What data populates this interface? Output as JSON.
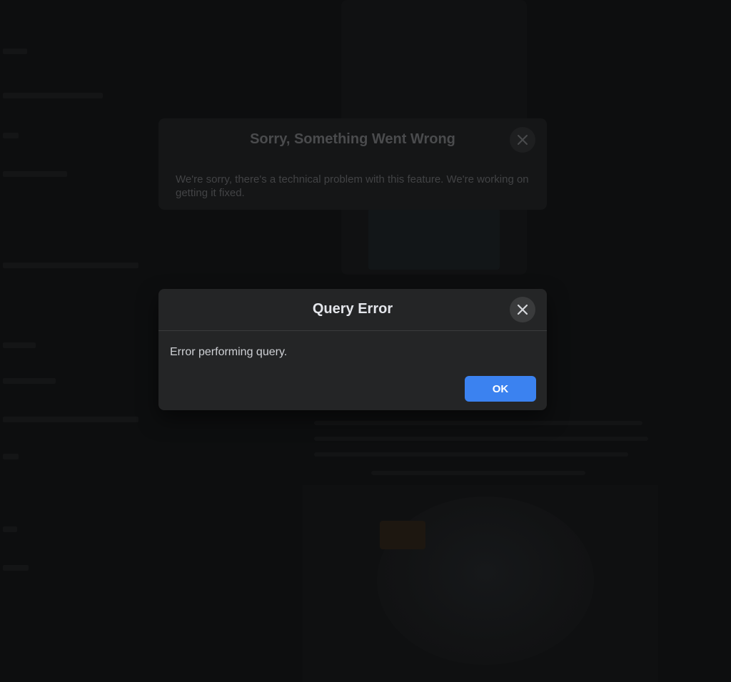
{
  "background_dialog": {
    "title": "Sorry, Something Went Wrong",
    "message": "We're sorry, there's a technical problem with this feature. We're working on getting it fixed.",
    "close_icon": "close-icon"
  },
  "dialog": {
    "title": "Query Error",
    "message": "Error performing query.",
    "ok_label": "OK",
    "close_icon": "close-icon"
  },
  "colors": {
    "primary_button": "#3b82f0",
    "dialog_background": "#242526",
    "page_background": "#0d0e0f"
  }
}
